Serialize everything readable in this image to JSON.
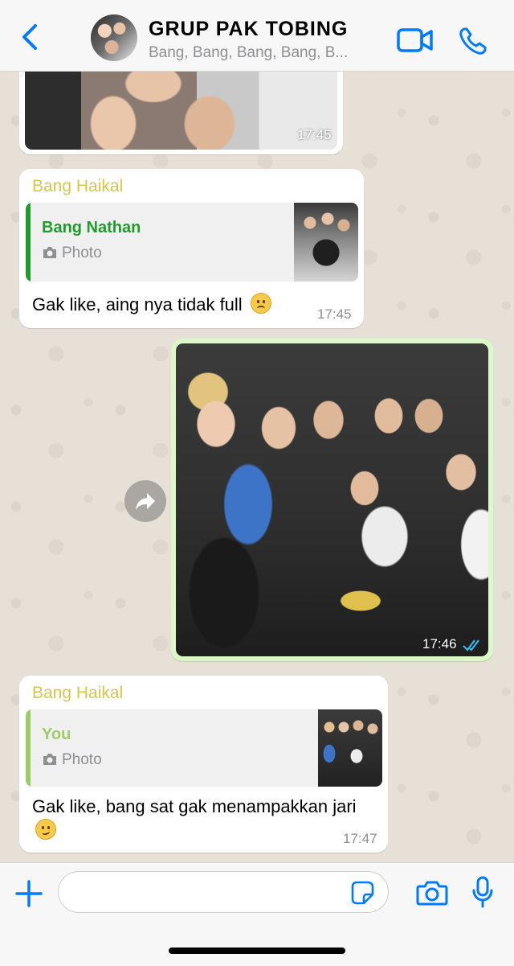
{
  "header": {
    "back_icon": "chevron-left-icon",
    "title": "GRUP PAK TOBING",
    "members": "Bang, Bang, Bang, Bang, B...",
    "accent": "#007aff"
  },
  "messages": [
    {
      "type": "photo",
      "direction": "incoming",
      "time": "17:45"
    },
    {
      "type": "reply",
      "direction": "incoming",
      "sender": "Bang Haikal",
      "quote": {
        "author": "Bang Nathan",
        "kind": "Photo",
        "bar_color": "#1f9b2b"
      },
      "text": "Gak like, aing nya tidak full",
      "emoji": "frowning-face",
      "time": "17:45"
    },
    {
      "type": "photo",
      "direction": "outgoing",
      "time": "17:46",
      "status": "read",
      "read_color": "#34b7f1"
    },
    {
      "type": "reply",
      "direction": "incoming",
      "sender": "Bang Haikal",
      "quote": {
        "author": "You",
        "kind": "Photo",
        "bar_color": "#9ccc65"
      },
      "text": "Gak like, bang sat gak menampakkan jari",
      "emoji": "unamused-face",
      "time": "17:47"
    }
  ],
  "sender_color": "#d6c64a",
  "input": {
    "placeholder": ""
  }
}
